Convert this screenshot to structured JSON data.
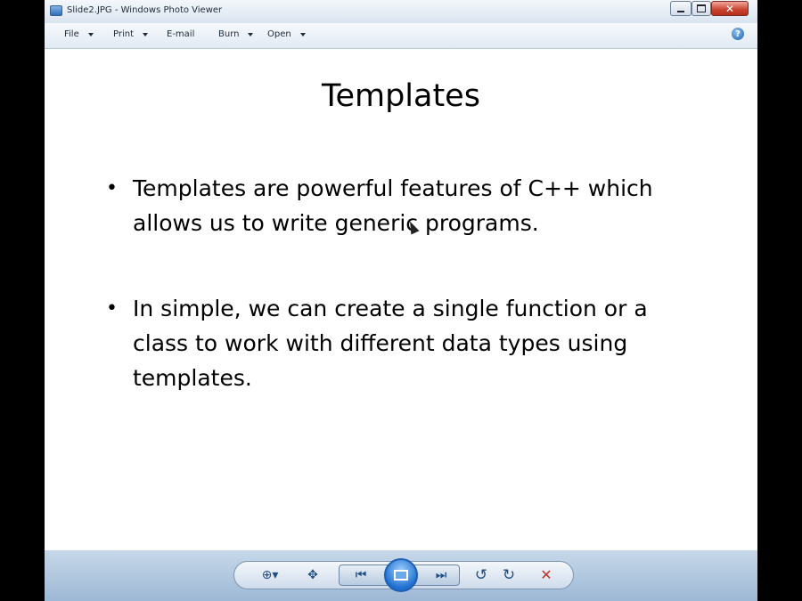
{
  "window": {
    "title": "Slide2.JPG - Windows Photo Viewer",
    "minimize_icon": "minimize-icon",
    "maximize_icon": "maximize-icon",
    "close_label": "✕"
  },
  "menu": {
    "items": [
      {
        "label": "File",
        "has_dropdown": true
      },
      {
        "label": "Print",
        "has_dropdown": true
      },
      {
        "label": "E-mail",
        "has_dropdown": false
      },
      {
        "label": "Burn",
        "has_dropdown": true
      },
      {
        "label": "Open",
        "has_dropdown": true
      }
    ],
    "help_label": "?"
  },
  "slide": {
    "title": "Templates",
    "bullets": [
      "Templates are powerful features of C++ which allows us to write generic programs.",
      " In simple, we can create a single function or a class to work with different data types using templates."
    ],
    "bullet_char": "•"
  },
  "toolbar": {
    "icons": [
      "zoom-icon",
      "actual-size-icon",
      "previous-icon",
      "slideshow-icon",
      "next-icon",
      "rotate-counterclockwise-icon",
      "rotate-clockwise-icon",
      "delete-icon"
    ],
    "zoom_glyph": "⊕▾",
    "actual_size_glyph": "✥",
    "previous_glyph": "⏮",
    "next_glyph": "⏭",
    "rotate_ccw_glyph": "↺",
    "rotate_cw_glyph": "↻",
    "delete_glyph": "✕"
  },
  "colors": {
    "titlebar": "#dbe6f1",
    "accent": "#1f6fd0",
    "close_red": "#c9412d",
    "delete_red": "#c0302a"
  }
}
